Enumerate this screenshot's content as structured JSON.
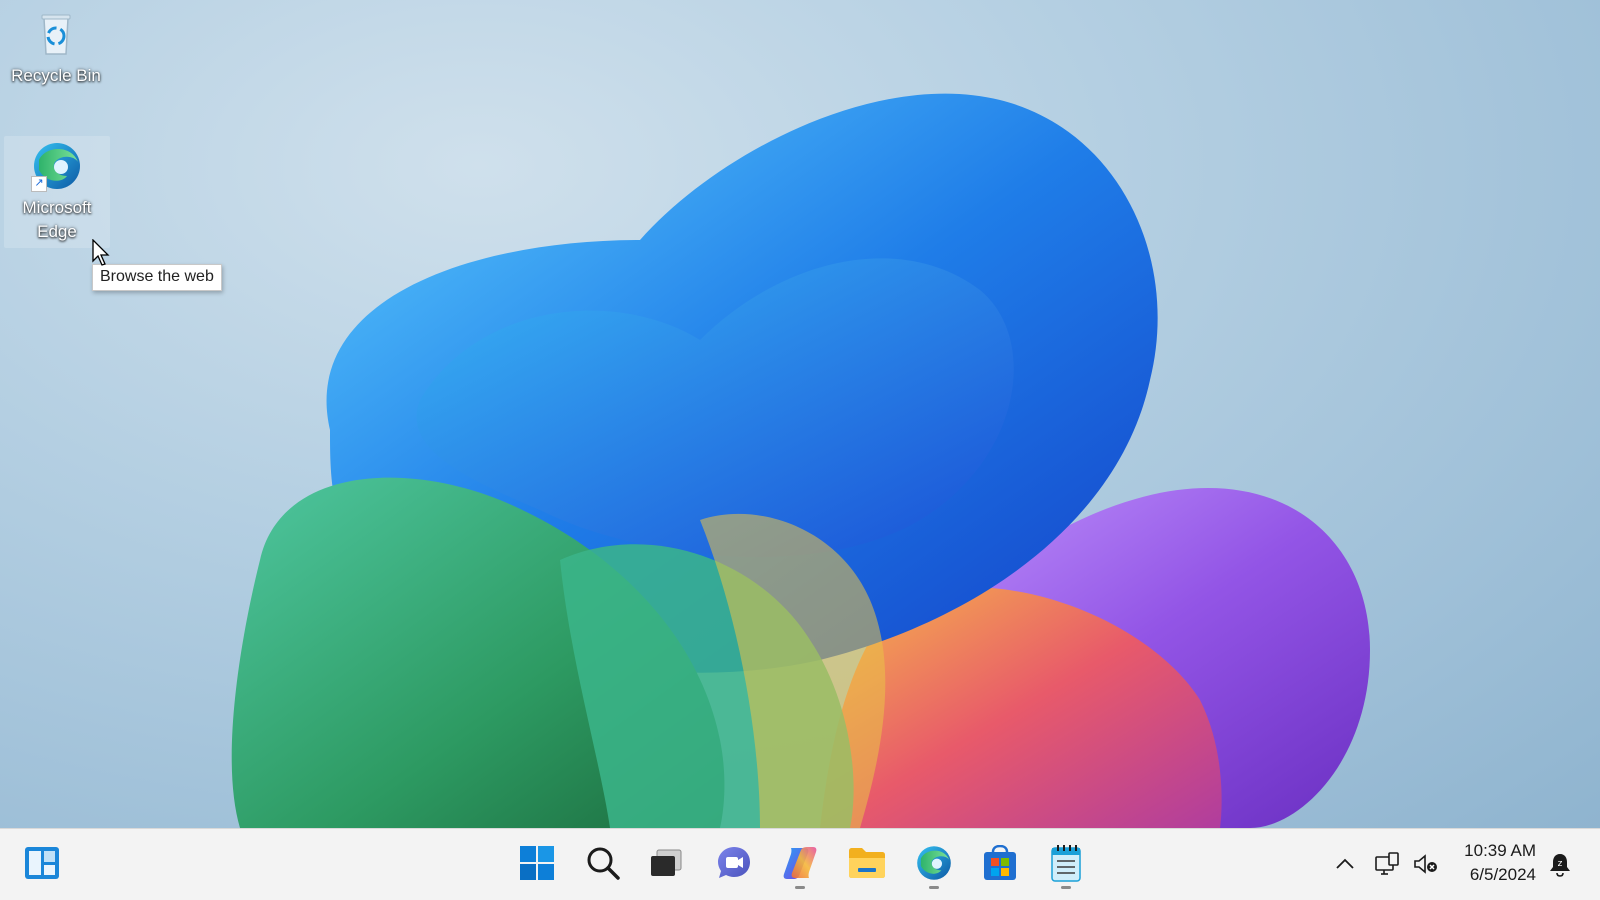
{
  "desktop": {
    "icons": [
      {
        "label": "Recycle Bin",
        "icon": "recycle-bin-icon"
      },
      {
        "label": "Microsoft Edge",
        "icon": "edge-icon"
      }
    ],
    "tooltip": "Browse the web"
  },
  "taskbar": {
    "left_widget": "widgets-icon",
    "pinned": [
      {
        "name": "Start",
        "icon": "windows-start-icon"
      },
      {
        "name": "Search",
        "icon": "search-icon"
      },
      {
        "name": "Task View",
        "icon": "task-view-icon"
      },
      {
        "name": "Teams Meet",
        "icon": "teams-meet-icon"
      },
      {
        "name": "Copilot",
        "icon": "copilot-icon",
        "running": true
      },
      {
        "name": "File Explorer",
        "icon": "folder-icon"
      },
      {
        "name": "Microsoft Edge",
        "icon": "edge-icon",
        "running": true
      },
      {
        "name": "Microsoft Store",
        "icon": "store-icon"
      },
      {
        "name": "Notepad",
        "icon": "notepad-icon",
        "running": true
      }
    ],
    "tray": {
      "icons": [
        "chevron-up-icon",
        "display-icon",
        "speaker-muted-icon",
        "notification-bell-icon"
      ],
      "time": "10:39 AM",
      "date": "6/5/2024"
    }
  },
  "colors": {
    "taskbar_bg": "#f3f3f3",
    "accent": "#0078d4"
  }
}
